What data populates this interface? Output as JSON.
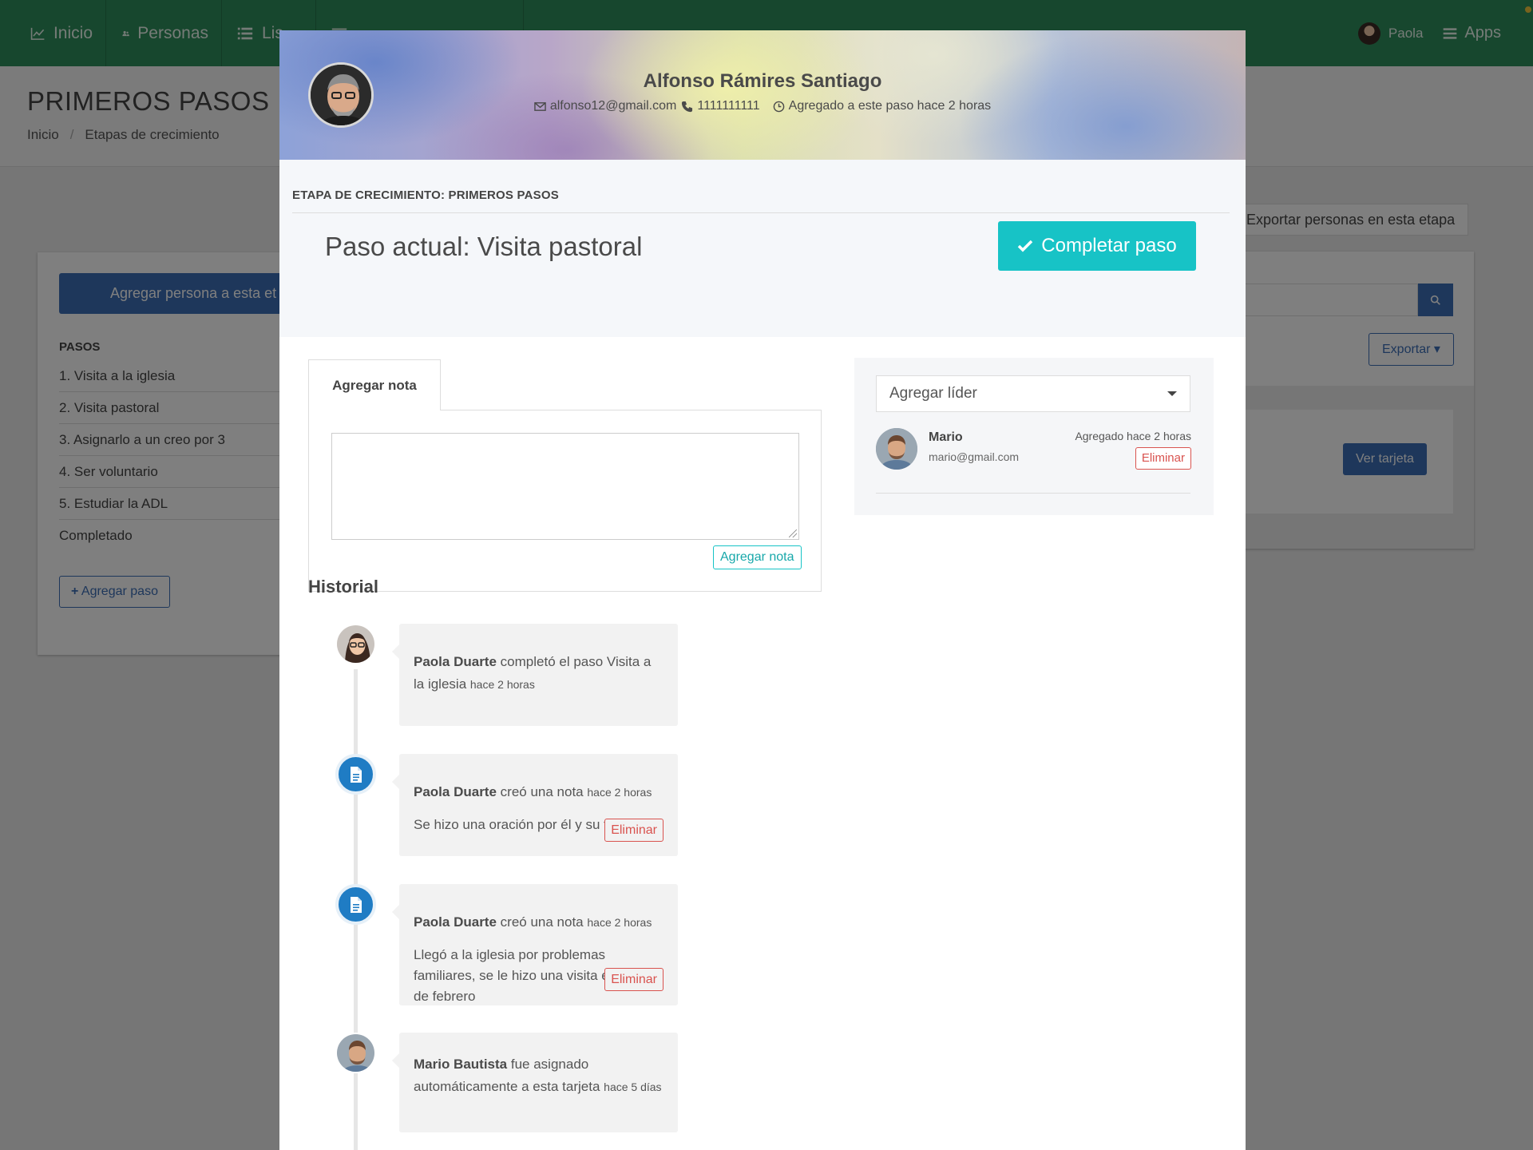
{
  "topnav": {
    "items": [
      {
        "label": "Inicio",
        "icon": "chart-line-icon"
      },
      {
        "label": "Personas",
        "icon": "users-icon"
      },
      {
        "label": "Lis",
        "icon": "list-icon"
      },
      {
        "label": "",
        "icon": "sliders-icon"
      }
    ],
    "user_name": "Paola",
    "apps_label": "Apps",
    "colors": {
      "nav_bg": "#2f8f5c"
    }
  },
  "page": {
    "title": "PRIMEROS PASOS",
    "breadcrumb": [
      "Inicio",
      "Etapas de crecimiento"
    ],
    "breadcrumb_sep": "/"
  },
  "left_card": {
    "add_person_label": "Agregar persona a esta et",
    "steps_title": "PASOS",
    "steps": [
      "1. Visita a la iglesia",
      "2. Visita pastoral",
      "3. Asignarlo a un creo por 3",
      "4. Ser voluntario",
      "5. Estudiar la ADL",
      "Completado"
    ],
    "add_step_label": "Agregar paso"
  },
  "right_card": {
    "export_stage_label": "Exportar personas en esta etapa",
    "export_label": "Exportar",
    "view_card_label": "Ver tarjeta"
  },
  "modal": {
    "client": {
      "name": "Alfonso Rámires Santiago",
      "email": "alfonso12@gmail.com",
      "phone": "1111111111",
      "added": "Agregado a este paso hace 2 horas"
    },
    "stage_title": "ETAPA DE CRECIMIENTO: PRIMEROS PASOS",
    "current_step": "Paso actual: Visita pastoral",
    "complete_label": "Completar paso",
    "note_tab_label": "Agregar nota",
    "note_placeholder": "",
    "note_submit_label": "Agregar nota",
    "leaders": {
      "select_label": "Agregar líder",
      "items": [
        {
          "name": "Mario",
          "email": "mario@gmail.com",
          "added": "Agregado hace 2 horas",
          "remove_label": "Eliminar"
        }
      ]
    },
    "history_title": "Historial",
    "history": [
      {
        "actor": "Paola Duarte",
        "action": "completó el paso Visita a la iglesia",
        "time": "hace 2 horas",
        "note": "",
        "remove_label": ""
      },
      {
        "actor": "Paola Duarte",
        "action": "creó una nota",
        "time": "hace 2 horas",
        "note": "Se hizo una oración por él y su familia.",
        "remove_label": "Eliminar"
      },
      {
        "actor": "Paola Duarte",
        "action": "creó una nota",
        "time": "hace 2 horas",
        "note": "Llegó a la iglesia por problemas familiares, se le hizo una visita el día 1 de febrero",
        "remove_label": "Eliminar"
      },
      {
        "actor": "Mario Bautista",
        "action": "fue asignado automáticamente a esta tarjeta",
        "time": "hace 5 días",
        "note": "",
        "remove_label": ""
      }
    ],
    "colors": {
      "accent": "#17c3c6",
      "danger": "#d9534f",
      "primary": "#3c6fb6",
      "note_icon": "#1f7cc4"
    }
  }
}
